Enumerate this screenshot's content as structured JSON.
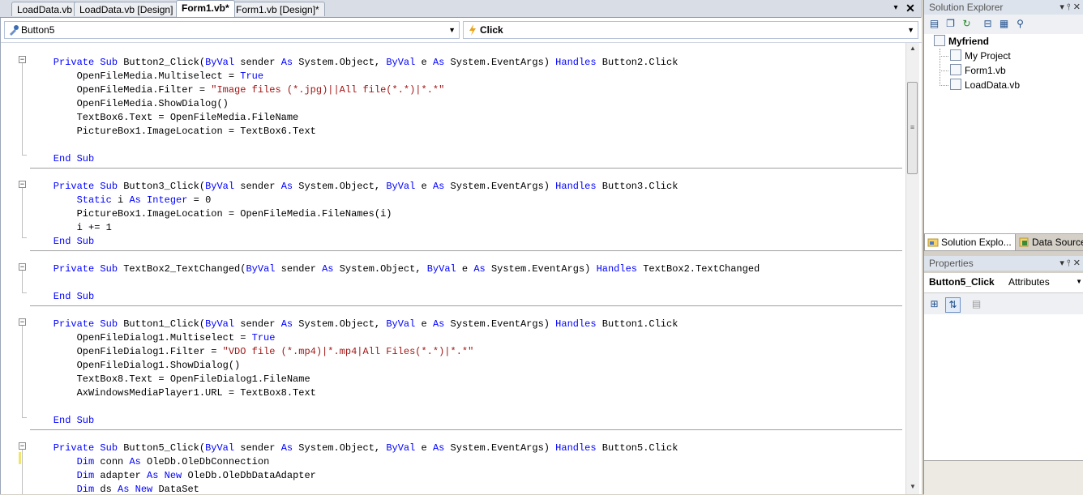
{
  "doc_tabs": {
    "tab1": "LoadData.vb",
    "tab2": "LoadData.vb [Design]",
    "tab3": "Form1.vb*",
    "tab4": "Form1.vb [Design]*",
    "dropdown_icon": "▾",
    "close_icon": "✕"
  },
  "navbar": {
    "object_combo": "Button5",
    "event_combo": "Click"
  },
  "code": {
    "l1": {
      "a": "    Private Sub",
      "b": " Button2_Click(",
      "c": "ByVal",
      "d": " sender ",
      "e": "As",
      "f": " System.Object, ",
      "g": "ByVal",
      "h": " e ",
      "i": "As",
      "j": " System.EventArgs) ",
      "k": "Handles",
      "l": " Button2.Click"
    },
    "l2": {
      "a": "        OpenFileMedia.Multiselect = ",
      "b": "True"
    },
    "l3": {
      "a": "        OpenFileMedia.Filter = ",
      "b": "\"Image files (*.jpg)||All file(*.*)|*.*\""
    },
    "l4": "        OpenFileMedia.ShowDialog()",
    "l5": "        TextBox6.Text = OpenFileMedia.FileName",
    "l6": "        PictureBox1.ImageLocation = TextBox6.Text",
    "l7": "    End Sub",
    "l8": {
      "a": "    Private Sub",
      "b": " Button3_Click(",
      "c": "ByVal",
      "d": " sender ",
      "e": "As",
      "f": " System.Object, ",
      "g": "ByVal",
      "h": " e ",
      "i": "As",
      "j": " System.EventArgs) ",
      "k": "Handles",
      "l": " Button3.Click"
    },
    "l9": {
      "a": "        Static",
      "b": " i ",
      "c": "As",
      "d": " ",
      "e": "Integer",
      "f": " = 0"
    },
    "l10": "        PictureBox1.ImageLocation = OpenFileMedia.FileNames(i)",
    "l11": "        i += 1",
    "l12": "    End Sub",
    "l13": {
      "a": "    Private Sub",
      "b": " TextBox2_TextChanged(",
      "c": "ByVal",
      "d": " sender ",
      "e": "As",
      "f": " System.Object, ",
      "g": "ByVal",
      "h": " e ",
      "i": "As",
      "j": " System.EventArgs) ",
      "k": "Handles",
      "l": " TextBox2.TextChanged"
    },
    "l14": "    End Sub",
    "l15": {
      "a": "    Private Sub",
      "b": " Button1_Click(",
      "c": "ByVal",
      "d": " sender ",
      "e": "As",
      "f": " System.Object, ",
      "g": "ByVal",
      "h": " e ",
      "i": "As",
      "j": " System.EventArgs) ",
      "k": "Handles",
      "l": " Button1.Click"
    },
    "l16": {
      "a": "        OpenFileDialog1.Multiselect = ",
      "b": "True"
    },
    "l17": {
      "a": "        OpenFileDialog1.Filter = ",
      "b": "\"VDO file (*.mp4)|*.mp4|All Files(*.*)|*.*\""
    },
    "l18": "        OpenFileDialog1.ShowDialog()",
    "l19": "        TextBox8.Text = OpenFileDialog1.FileName",
    "l20": "        AxWindowsMediaPlayer1.URL = TextBox8.Text",
    "l21": "    End Sub",
    "l22": {
      "a": "    Private Sub",
      "b": " Button5_Click(",
      "c": "ByVal",
      "d": " sender ",
      "e": "As",
      "f": " System.Object, ",
      "g": "ByVal",
      "h": " e ",
      "i": "As",
      "j": " System.EventArgs) ",
      "k": "Handles",
      "l": " Button5.Click"
    },
    "l23": {
      "a": "        Dim",
      "b": " conn ",
      "c": "As",
      "d": " OleDb.OleDbConnection"
    },
    "l24": {
      "a": "        Dim",
      "b": " adapter ",
      "c": "As",
      "d": " ",
      "e": "New",
      "f": " OleDb.OleDbDataAdapter"
    },
    "l25": {
      "a": "        Dim",
      "b": " ds ",
      "c": "As",
      "d": " ",
      "e": "New",
      "f": " DataSet"
    }
  },
  "solution_explorer": {
    "title": "Solution Explorer",
    "title_buttons": "▾ ⫯ ✕",
    "root": "Myfriend",
    "items": [
      "My Project",
      "Form1.vb",
      "LoadData.vb"
    ],
    "tab_solution": "Solution Explo...",
    "tab_data": "Data Sources"
  },
  "properties": {
    "title": "Properties",
    "title_buttons": "▾ ⫯ ✕",
    "object": "Button5_Click",
    "object_type": "Attributes"
  },
  "colors": {
    "keyword": "#0000ff",
    "string": "#a31515"
  }
}
